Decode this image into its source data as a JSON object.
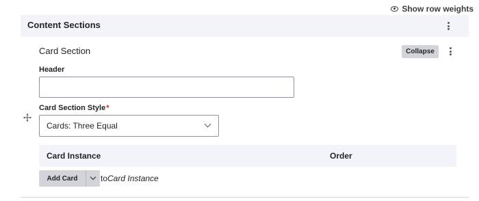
{
  "top_link": {
    "label": "Show row weights",
    "icon": "eye-icon"
  },
  "section": {
    "title": "Content Sections",
    "menu_icon": "kebab-icon"
  },
  "card": {
    "title": "Card Section",
    "collapse_label": "Collapse",
    "menu_icon": "kebab-icon",
    "header_label": "Header",
    "header_value": "",
    "style_label": "Card Section Style",
    "required_mark": "*",
    "style_selected": "Cards: Three Equal",
    "drag_icon": "move-arrows-icon"
  },
  "table": {
    "columns": [
      "Card Instance",
      "Order"
    ]
  },
  "add": {
    "button_label": "Add Card",
    "to_prefix": "to",
    "to_target": "Card Instance"
  },
  "colors": {
    "band_bg": "#f3f4f9",
    "button_bg": "#d3d4d9",
    "required": "#dc2323",
    "text": "#232429"
  }
}
